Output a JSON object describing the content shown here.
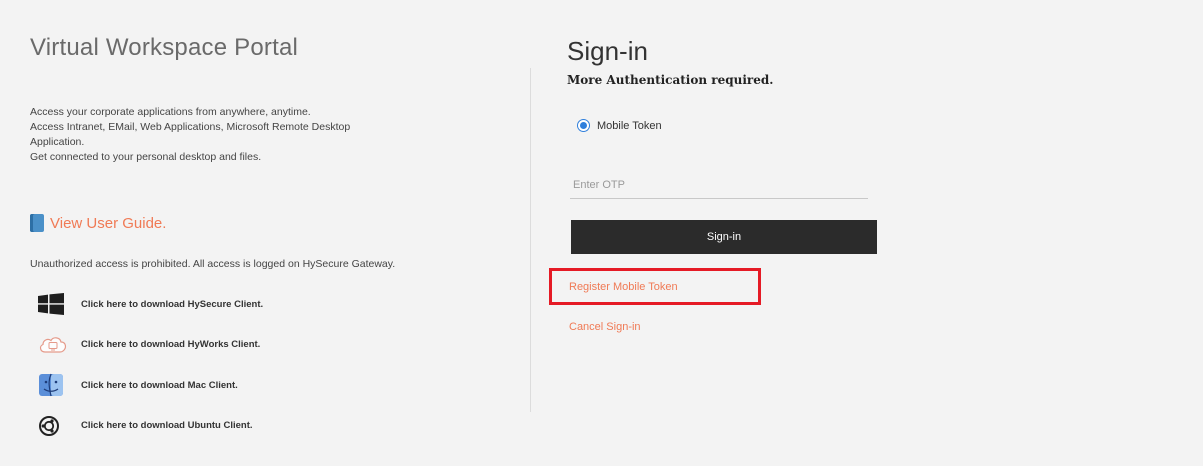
{
  "portal": {
    "title": "Virtual Workspace Portal",
    "description_lines": [
      "Access your corporate applications from anywhere, anytime.",
      "Access Intranet, EMail, Web Applications, Microsoft Remote Desktop",
      "Application.",
      "Get connected to your personal desktop and files."
    ],
    "guide_link": "View User Guide.",
    "notice": "Unauthorized access is prohibited. All access is logged on HySecure Gateway.",
    "downloads": [
      {
        "icon": "windows-icon",
        "label": "Click here to download HySecure Client."
      },
      {
        "icon": "cloud-icon",
        "label": "Click here to download HyWorks Client."
      },
      {
        "icon": "mac-finder-icon",
        "label": "Click here to download Mac Client."
      },
      {
        "icon": "ubuntu-icon",
        "label": "Click here to download Ubuntu Client."
      }
    ]
  },
  "signin": {
    "title": "Sign-in",
    "subtitle": "More Authentication required.",
    "radio_label": "Mobile Token",
    "otp_placeholder": "Enter OTP",
    "otp_value": "",
    "button_label": "Sign-in",
    "register_link": "Register Mobile Token",
    "cancel_link": "Cancel Sign-in"
  },
  "colors": {
    "accent_link": "#f07a55",
    "button_bg": "#2b2b2b",
    "highlight": "#e51a25",
    "radio": "#2f7fdc"
  }
}
